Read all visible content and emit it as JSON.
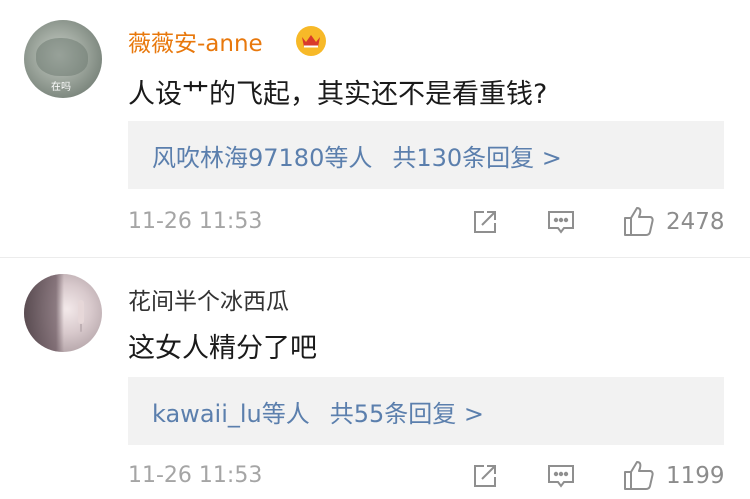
{
  "comments": [
    {
      "username": "薇薇安-anne",
      "avatar_badge": "在吗",
      "verified_icon": "crown-icon",
      "text": "人设艹的飞起，其实还不是看重钱?",
      "replies_who": "风吹林海97180等人",
      "replies_count": "共130条回复 >",
      "time": "11-26 11:53",
      "likes": "2478"
    },
    {
      "username": "花间半个冰西瓜",
      "text": "这女人精分了吧",
      "replies_who": "kawaii_lu等人",
      "replies_count": "共55条回复 >",
      "time": "11-26 11:53",
      "likes": "1199"
    }
  ],
  "colors": {
    "vip_name": "#e8780c",
    "link": "#5b7fad",
    "meta": "#a5a5a5"
  }
}
